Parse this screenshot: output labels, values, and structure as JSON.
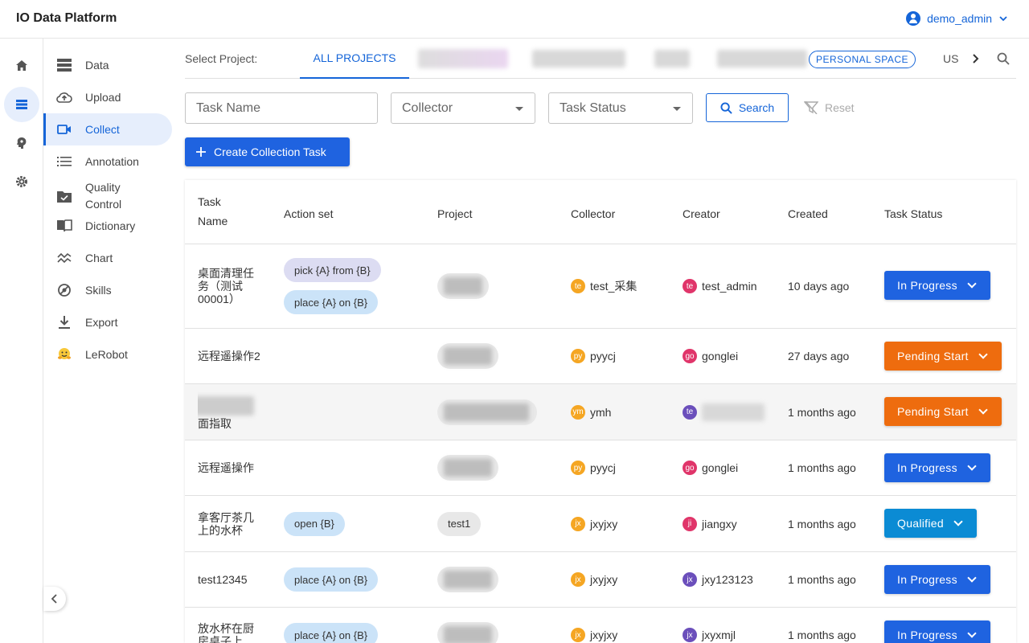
{
  "header": {
    "app_title": "IO Data Platform",
    "user_name": "demo_admin"
  },
  "sidebar": {
    "items": [
      {
        "label": "Data",
        "icon": "database-icon"
      },
      {
        "label": "Upload",
        "icon": "cloud-upload-icon"
      },
      {
        "label": "Collect",
        "icon": "video-camera-icon",
        "active": true
      },
      {
        "label": "Annotation",
        "icon": "list-icon"
      },
      {
        "label": "Quality Control",
        "icon": "folder-check-icon"
      },
      {
        "label": "Dictionary",
        "icon": "book-icon"
      },
      {
        "label": "Chart",
        "icon": "chart-line-icon"
      },
      {
        "label": "Skills",
        "icon": "skills-icon"
      },
      {
        "label": "Export",
        "icon": "download-icon"
      },
      {
        "label": "LeRobot",
        "icon": "hugging-face-emoji-icon"
      }
    ]
  },
  "project_bar": {
    "label": "Select Project:",
    "all_projects": "ALL PROJECTS",
    "personal_space": "PERSONAL SPACE",
    "truncated_tab": "US"
  },
  "filters": {
    "task_name_placeholder": "Task Name",
    "collector_placeholder": "Collector",
    "task_status_placeholder": "Task Status",
    "search_label": "Search",
    "reset_label": "Reset",
    "create_label": "Create Collection Task"
  },
  "table": {
    "columns": [
      "Task Name",
      "Action set",
      "Project",
      "Collector",
      "Creator",
      "Created",
      "Task Status"
    ],
    "rows": [
      {
        "task_name": "桌面清理任务（测试00001）",
        "actions": [
          "pick {A} from {B}",
          "place {A} on {B}"
        ],
        "project": "",
        "collector": "test_采集",
        "collector_initials": "te",
        "creator": "test_admin",
        "creator_initials": "te",
        "created": "10 days ago",
        "status": "In Progress"
      },
      {
        "task_name": "远程遥操作2",
        "actions": [],
        "project": "",
        "collector": "pyycj",
        "collector_initials": "py",
        "creator": "gonglei",
        "creator_initials": "go",
        "created": "27 days ago",
        "status": "Pending Start"
      },
      {
        "task_name": "面指取",
        "actions": [],
        "project": "",
        "collector": "ymh",
        "collector_initials": "ym",
        "creator": "",
        "creator_initials": "te",
        "created": "1 months ago",
        "status": "Pending Start"
      },
      {
        "task_name": "远程遥操作",
        "actions": [],
        "project": "",
        "collector": "pyycj",
        "collector_initials": "py",
        "creator": "gonglei",
        "creator_initials": "go",
        "created": "1 months ago",
        "status": "In Progress"
      },
      {
        "task_name": "拿客厅茶几上的水杯",
        "actions": [
          "open {B}"
        ],
        "project": "test1",
        "collector": "jxyjxy",
        "collector_initials": "jx",
        "creator": "jiangxy",
        "creator_initials": "ji",
        "created": "1 months ago",
        "status": "Qualified"
      },
      {
        "task_name": "test12345",
        "actions": [
          "place {A} on {B}"
        ],
        "project": "",
        "collector": "jxyjxy",
        "collector_initials": "jx",
        "creator": "jxy123123",
        "creator_initials": "jx",
        "created": "1 months ago",
        "status": "In Progress"
      },
      {
        "task_name": "放水杯在厨房桌子上",
        "actions": [
          "place {A} on {B}"
        ],
        "project": "",
        "collector": "jxyjxy",
        "collector_initials": "jx",
        "creator": "jxyxmjl",
        "creator_initials": "jx",
        "created": "1 months ago",
        "status": "In Progress"
      }
    ]
  },
  "colors": {
    "primary": "#1f63e0",
    "in_progress": "#1f63e0",
    "pending_start": "#ee6c0e",
    "qualified": "#0b8bd4",
    "avatar_orange": "#f5a623",
    "avatar_pink": "#e0356a",
    "avatar_purple": "#6b4fbb"
  }
}
